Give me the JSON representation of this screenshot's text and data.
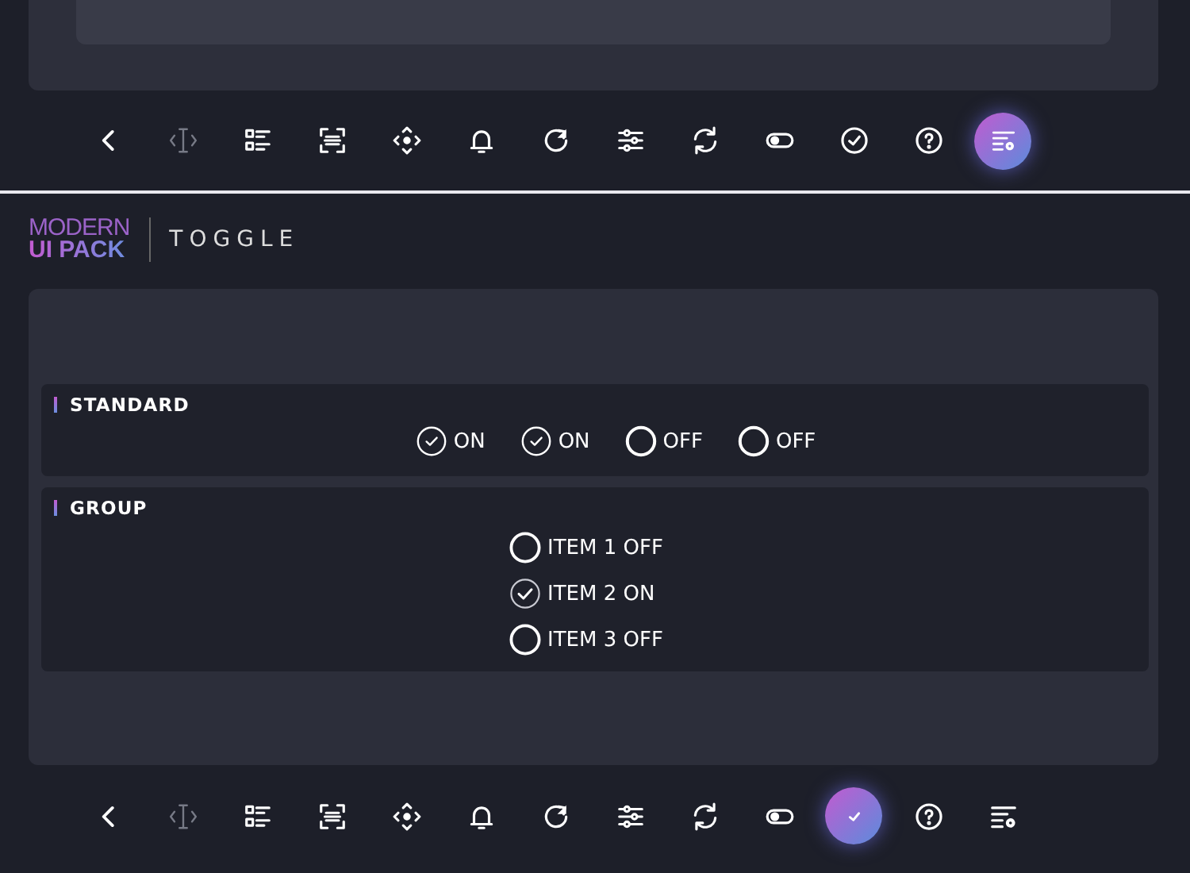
{
  "top_toolbar": {
    "items": [
      {
        "kind": "back",
        "selected": false,
        "disabled": false
      },
      {
        "kind": "text-cursor",
        "selected": false,
        "disabled": true
      },
      {
        "kind": "list",
        "selected": false,
        "disabled": false
      },
      {
        "kind": "scan",
        "selected": false,
        "disabled": false
      },
      {
        "kind": "move",
        "selected": false,
        "disabled": false
      },
      {
        "kind": "bell",
        "selected": false,
        "disabled": false
      },
      {
        "kind": "reload",
        "selected": false,
        "disabled": false
      },
      {
        "kind": "sliders",
        "selected": false,
        "disabled": false
      },
      {
        "kind": "refresh",
        "selected": false,
        "disabled": false
      },
      {
        "kind": "toggle",
        "selected": false,
        "disabled": false
      },
      {
        "kind": "check",
        "selected": false,
        "disabled": false
      },
      {
        "kind": "help",
        "selected": false,
        "disabled": false
      },
      {
        "kind": "list-settings",
        "selected": true,
        "disabled": false
      }
    ]
  },
  "header": {
    "logo_line_1": "MODERN",
    "logo_line_2": "UI PACK",
    "title": "TOGGLE"
  },
  "standard": {
    "title": "STANDARD",
    "toggles": [
      {
        "label": "ON",
        "checked": true
      },
      {
        "label": "ON",
        "checked": true
      },
      {
        "label": "OFF",
        "checked": false
      },
      {
        "label": "OFF",
        "checked": false
      }
    ]
  },
  "group": {
    "title": "GROUP",
    "items": [
      {
        "label": "ITEM 1 OFF",
        "selected": false
      },
      {
        "label": "ITEM 2 ON",
        "selected": true
      },
      {
        "label": "ITEM 3 OFF",
        "selected": false
      }
    ]
  },
  "bottom_toolbar": {
    "items": [
      {
        "kind": "back",
        "selected": false,
        "disabled": false
      },
      {
        "kind": "text-cursor",
        "selected": false,
        "disabled": true
      },
      {
        "kind": "list",
        "selected": false,
        "disabled": false
      },
      {
        "kind": "scan",
        "selected": false,
        "disabled": false
      },
      {
        "kind": "move",
        "selected": false,
        "disabled": false
      },
      {
        "kind": "bell",
        "selected": false,
        "disabled": false
      },
      {
        "kind": "reload",
        "selected": false,
        "disabled": false
      },
      {
        "kind": "sliders",
        "selected": false,
        "disabled": false
      },
      {
        "kind": "refresh",
        "selected": false,
        "disabled": false
      },
      {
        "kind": "toggle",
        "selected": false,
        "disabled": false
      },
      {
        "kind": "check",
        "selected": true,
        "disabled": false
      },
      {
        "kind": "help",
        "selected": false,
        "disabled": false
      },
      {
        "kind": "list-settings",
        "selected": false,
        "disabled": false
      }
    ]
  }
}
